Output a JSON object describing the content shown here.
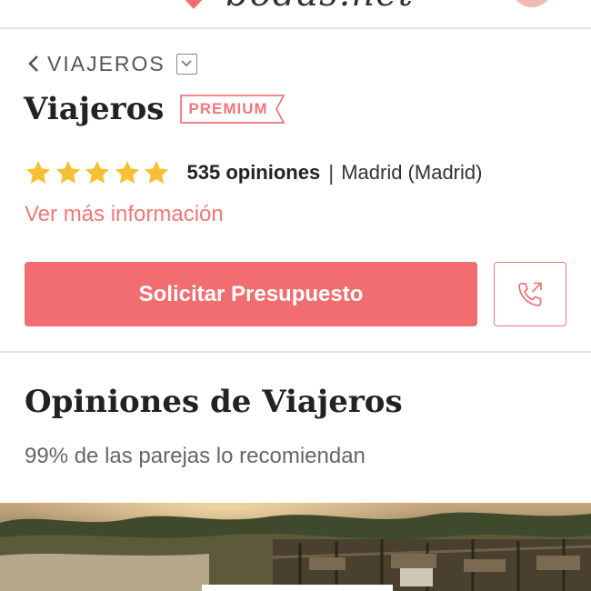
{
  "header": {
    "logo_icon": "heart-logo-icon",
    "logo_text": "bodas.net",
    "avatar_color": "#f2b9b6"
  },
  "breadcrumb": {
    "back_icon": "chevron-left-icon",
    "label": "VIAJEROS",
    "dropdown_icon": "chevron-down-icon"
  },
  "vendor": {
    "name": "Viajeros",
    "badge": "PREMIUM",
    "rating": 5,
    "rating_max": 5,
    "reviews": "535 opiniones",
    "separator": "|",
    "location": "Madrid (Madrid)",
    "more_info": "Ver más información"
  },
  "actions": {
    "quote_label": "Solicitar Presupuesto",
    "phone_icon": "phone-call-icon"
  },
  "reviews_section": {
    "title": "Opiniones de Viajeros",
    "recommend_text": "99% de las parejas lo recomiendan"
  },
  "colors": {
    "accent": "#f26d6f",
    "accent_text": "#f0777a",
    "star": "#f5c033",
    "divider": "#e2e2e2"
  }
}
